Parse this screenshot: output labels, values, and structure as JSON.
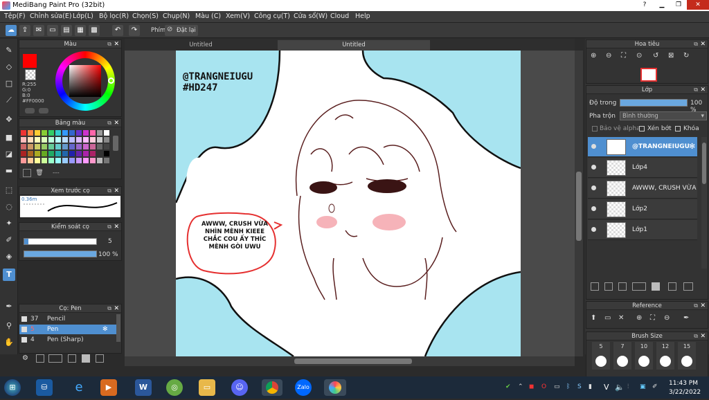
{
  "app": {
    "title": "MediBang Paint Pro (32bit)"
  },
  "menu": [
    "Tệp(F)",
    "Chỉnh sửa(E)",
    "Lớp(L)",
    "Bộ lọc(R)",
    "Chọn(S)",
    "Chụp(N)",
    "Màu (C)",
    "Xem(V)",
    "Công cụ(T)",
    "Cửa sổ(W)",
    "Cloud",
    "Help"
  ],
  "toolbar": {
    "label_phim": "Phím",
    "reset_label": "Đặt lại"
  },
  "tabs": [
    {
      "label": "Untitled"
    },
    {
      "label": "Untitled"
    }
  ],
  "color_panel": {
    "title": "Màu",
    "r": "R:255",
    "g": "G:0",
    "b": "B:0",
    "hex": "#FF0000",
    "accent": "#ff0000"
  },
  "palette_panel": {
    "title": "Bảng màu",
    "bottom": "---"
  },
  "brush_preview": {
    "title": "Xem trước cọ",
    "size": "0.36m"
  },
  "brush_control": {
    "title": "Kiểm soát cọ",
    "size_value": "5",
    "opacity_value": "100 %"
  },
  "brush_list": {
    "title": "Cọ: Pen",
    "items": [
      {
        "num": "37",
        "label": "Pencil",
        "active": false
      },
      {
        "num": "5",
        "label": "Pen",
        "active": true
      },
      {
        "num": "4",
        "label": "Pen (Sharp)",
        "active": false
      }
    ]
  },
  "canvas_art": {
    "watermark_line1": "@TRANGNEIUGU",
    "watermark_line2": "#HD247",
    "speech": [
      "AWWW, CRUSH VỪA",
      "NHÌN MÈNH KIEEE",
      "CHẮC COU ẤY THÍC",
      "MÈNH GÒI UWU"
    ]
  },
  "navigator": {
    "title": "Hoa tiêu"
  },
  "layer_panel": {
    "title": "Lớp",
    "opacity_label": "Độ trong",
    "opacity_value": "100 %",
    "blend_label": "Pha trộn",
    "blend_value": "Bình thường",
    "protect_alpha": "Bảo vệ alpha",
    "clipping": "Xén bớt",
    "lock": "Khóa",
    "layers": [
      {
        "name": "@TRANGNEIUGU",
        "selected": true
      },
      {
        "name": "Lớp4",
        "selected": false
      },
      {
        "name": "AWWW, CRUSH VỪA",
        "selected": false
      },
      {
        "name": "Lớp2",
        "selected": false
      },
      {
        "name": "Lớp1",
        "selected": false
      }
    ]
  },
  "reference": {
    "title": "Reference"
  },
  "brush_size": {
    "title": "Brush Size",
    "sizes": [
      "5",
      "7",
      "10",
      "12",
      "15"
    ]
  },
  "taskbar": {
    "time": "11:43 PM",
    "date": "3/22/2022",
    "lang": "V"
  }
}
